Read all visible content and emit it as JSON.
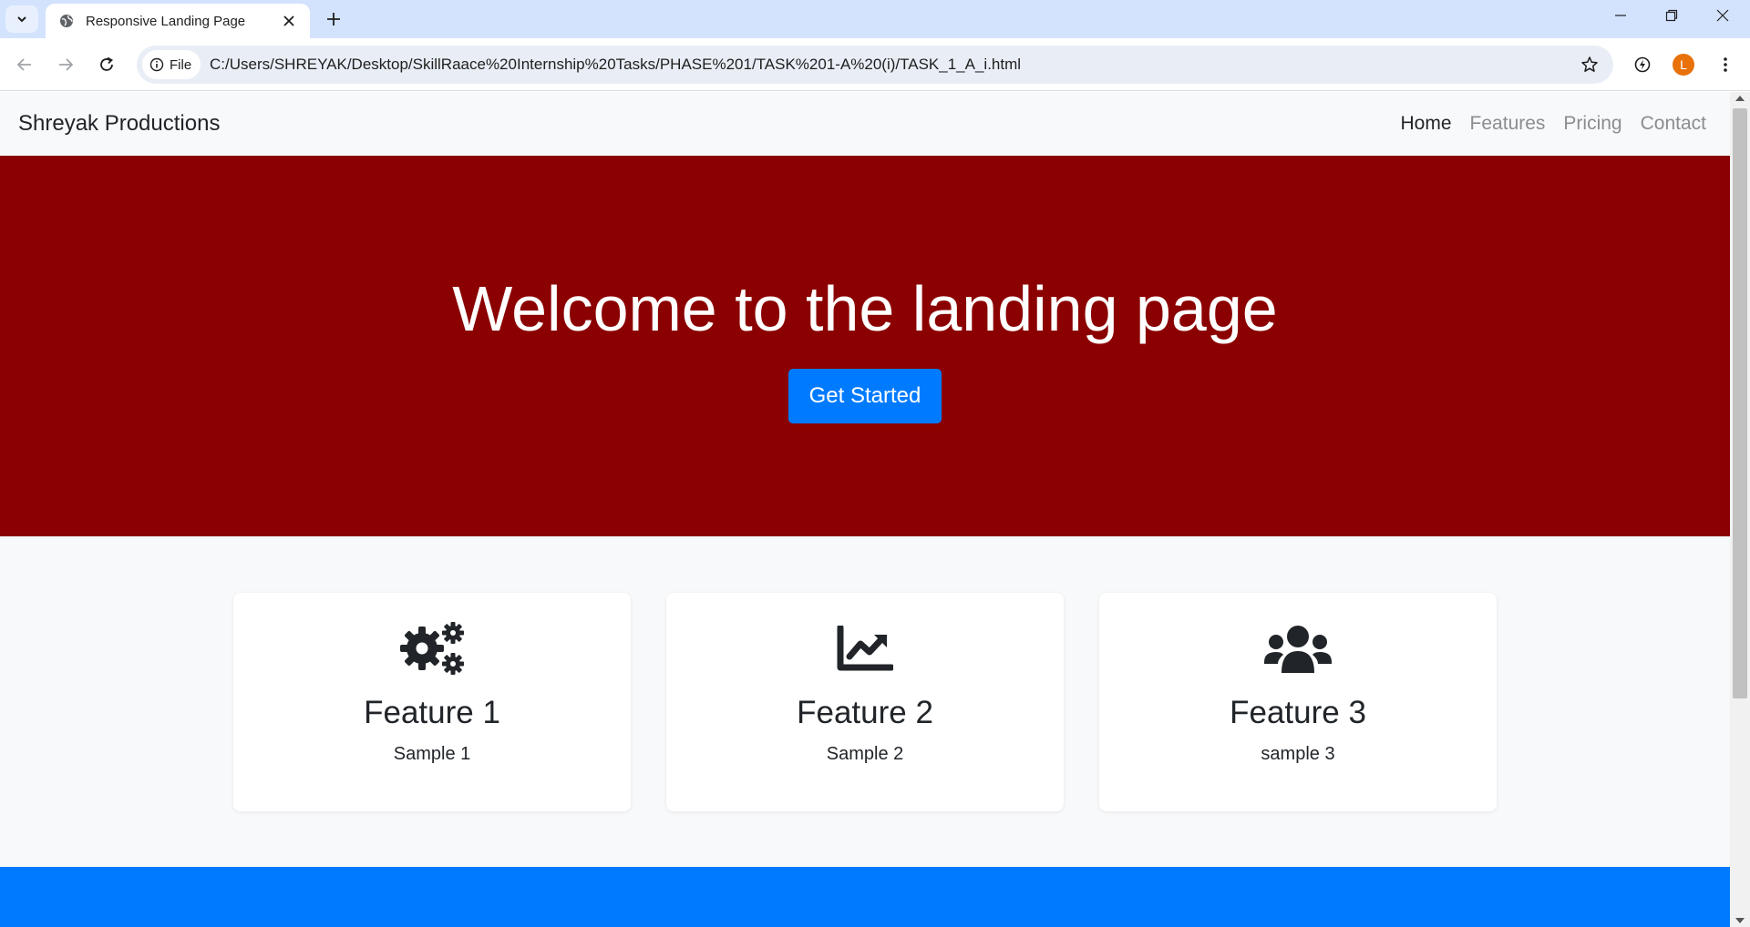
{
  "browser": {
    "tab_title": "Responsive Landing Page",
    "chip_label": "File",
    "url": "C:/Users/SHREYAK/Desktop/SkillRaace%20Internship%20Tasks/PHASE%201/TASK%201-A%20(i)/TASK_1_A_i.html",
    "profile_initial": "L"
  },
  "site": {
    "brand": "Shreyak Productions",
    "nav": [
      "Home",
      "Features",
      "Pricing",
      "Contact"
    ],
    "hero": {
      "title": "Welcome to the landing page",
      "cta": "Get Started",
      "bg_color": "#8b0000",
      "cta_color": "#007bff"
    },
    "features": [
      {
        "icon": "gears-icon",
        "title": "Feature 1",
        "text": "Sample 1"
      },
      {
        "icon": "chart-line-icon",
        "title": "Feature 2",
        "text": "Sample 2"
      },
      {
        "icon": "users-icon",
        "title": "Feature 3",
        "text": "sample 3"
      }
    ],
    "footer_color": "#007bff"
  }
}
